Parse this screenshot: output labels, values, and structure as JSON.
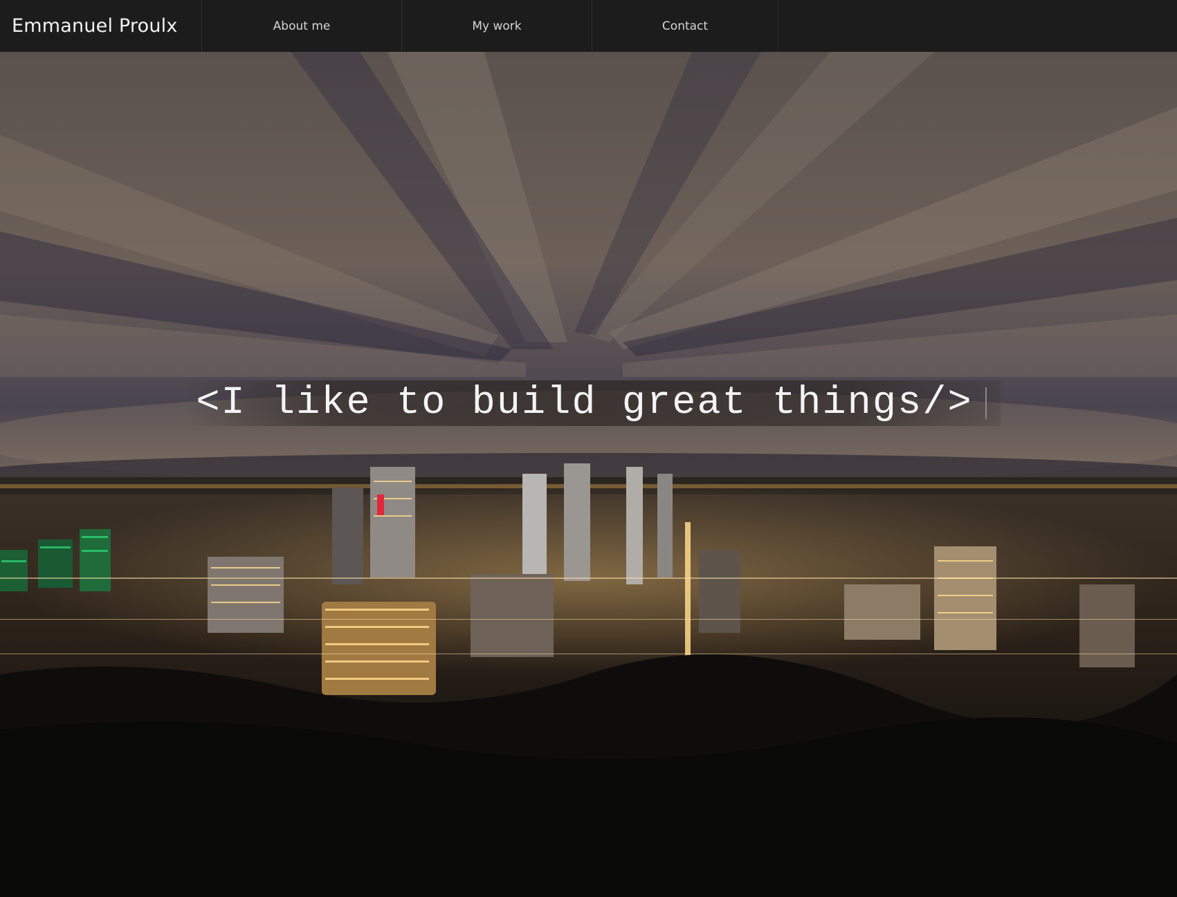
{
  "navbar": {
    "brand": "Emmanuel Proulx",
    "items": [
      {
        "label": "About me"
      },
      {
        "label": "My work"
      },
      {
        "label": "Contact"
      }
    ]
  },
  "hero": {
    "tagline": "<I like to build great things/>",
    "background_description_icon": "city-skyline-night-photo"
  },
  "colors": {
    "navbar_bg": "#1c1c1c",
    "nav_text": "#d6d6d6",
    "tagline_text": "#f4f4f4"
  }
}
